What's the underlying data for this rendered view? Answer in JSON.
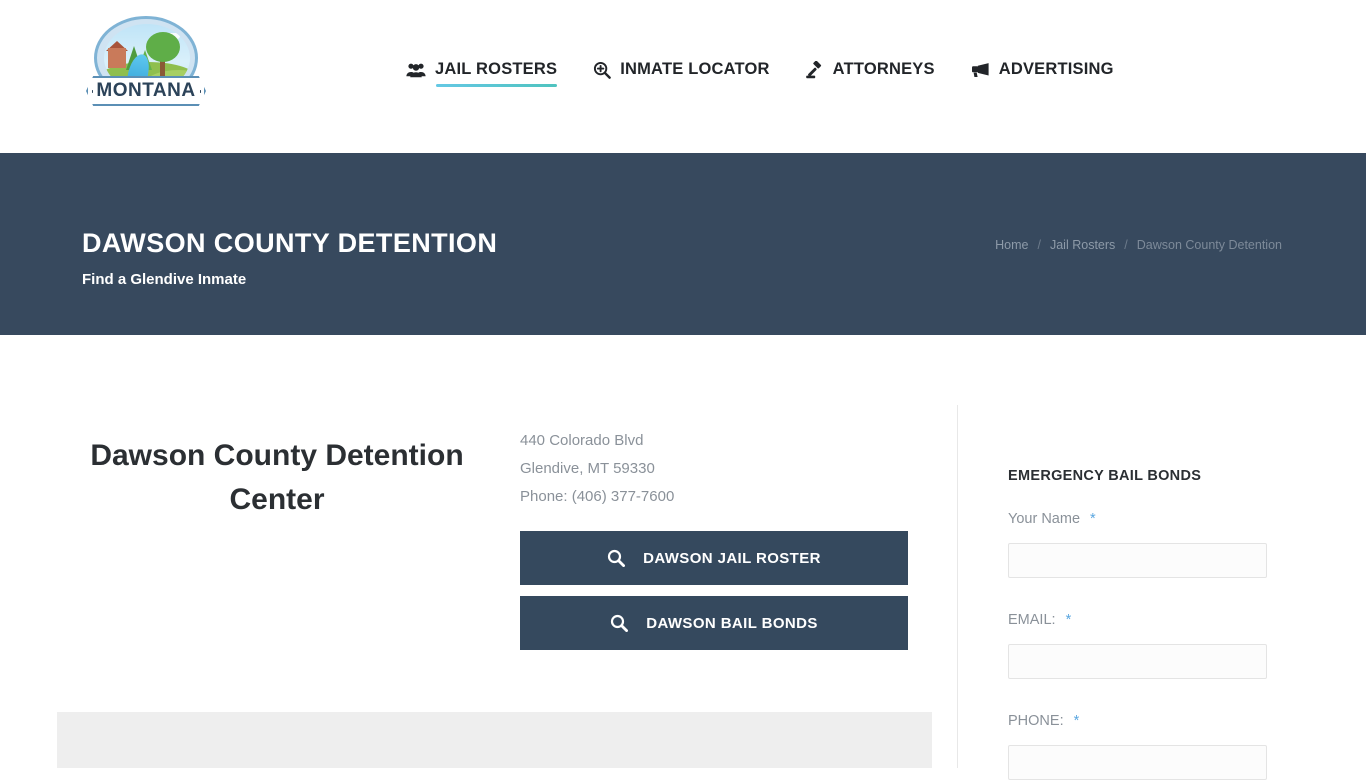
{
  "header": {
    "logo": {
      "name": "montana-logo",
      "plate_text": "MONTANA"
    },
    "nav": [
      {
        "label": "JAIL ROSTERS",
        "icon": "users-icon",
        "active": true
      },
      {
        "label": "INMATE LOCATOR",
        "icon": "search-plus-icon",
        "active": false
      },
      {
        "label": "ATTORNEYS",
        "icon": "gavel-icon",
        "active": false
      },
      {
        "label": "ADVERTISING",
        "icon": "bullhorn-icon",
        "active": false
      }
    ]
  },
  "banner": {
    "title": "DAWSON COUNTY DETENTION",
    "subtitle": "Find a Glendive Inmate",
    "background_color": "#37495e",
    "breadcrumb": [
      {
        "label": "Home",
        "current": false
      },
      {
        "label": "Jail Rosters",
        "current": false
      },
      {
        "label": "Dawson County Detention",
        "current": true
      }
    ],
    "breadcrumb_separator": "/"
  },
  "main": {
    "facility_name": "Dawson County Detention Center",
    "address": {
      "street": "440 Colorado Blvd",
      "city_state_zip": "Glendive, MT 59330",
      "phone": "Phone: (406) 377-7600"
    },
    "buttons": [
      {
        "label": "DAWSON JAIL ROSTER",
        "icon": "search-icon"
      },
      {
        "label": "DAWSON BAIL BONDS",
        "icon": "search-icon"
      }
    ],
    "button_color": "#35495e"
  },
  "sidebar": {
    "title": "EMERGENCY BAIL BONDS",
    "required_marker": "*",
    "required_color": "#5ba7e0",
    "fields": [
      {
        "label": "Your Name",
        "value": "",
        "placeholder": ""
      },
      {
        "label": "EMAIL:",
        "value": "",
        "placeholder": ""
      },
      {
        "label": "PHONE:",
        "value": "",
        "placeholder": ""
      }
    ]
  }
}
